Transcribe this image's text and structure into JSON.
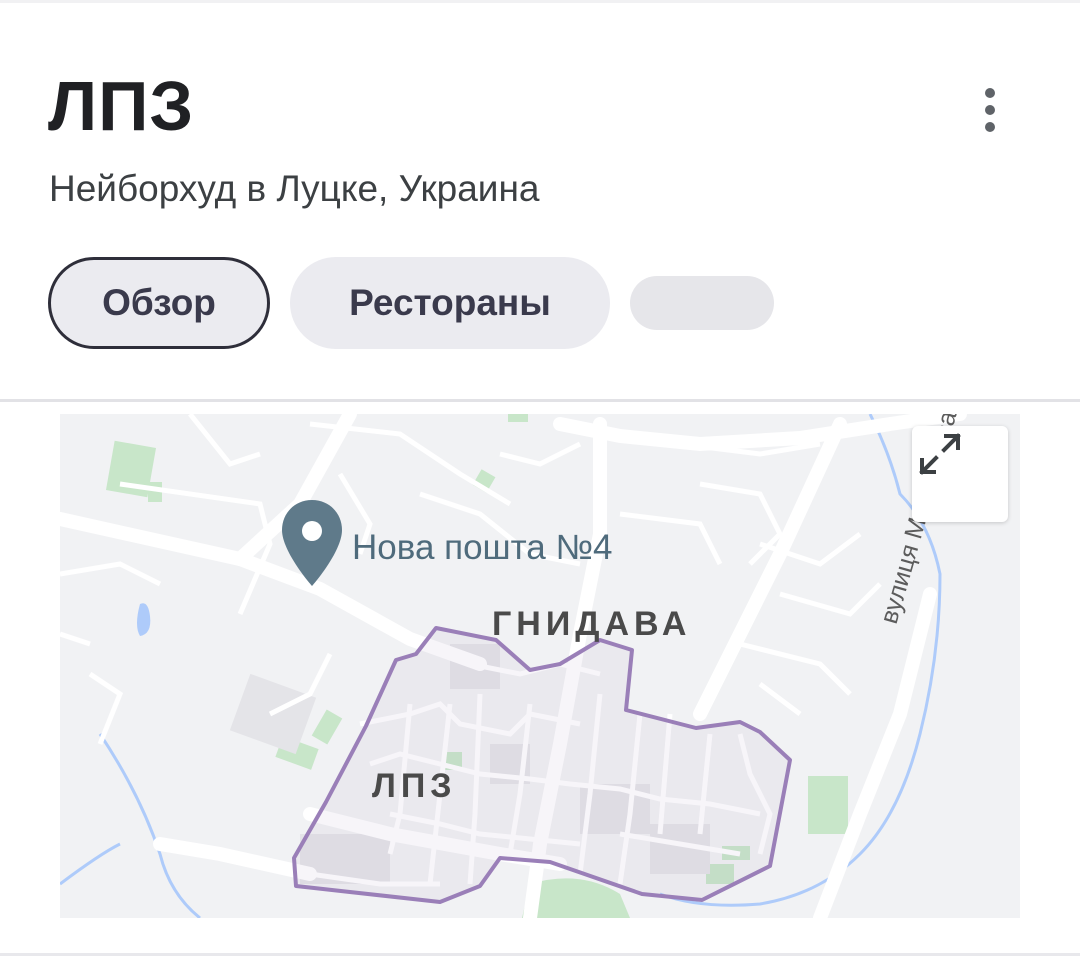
{
  "header": {
    "title": "ЛПЗ",
    "subtitle": "Нейборхуд в Луцке, Украина",
    "menu_icon": "more-vert-icon"
  },
  "chips": [
    {
      "label": "Обзор",
      "selected": true
    },
    {
      "label": "Рестораны",
      "selected": false
    },
    {
      "label": "",
      "placeholder": true
    }
  ],
  "map": {
    "poi": {
      "label": "Нова пошта №4",
      "icon": "map-pin-icon"
    },
    "areas": [
      {
        "label": "ГНИДАВА"
      },
      {
        "label": "ЛПЗ"
      }
    ],
    "street": "вулиця Мамсурова",
    "expand_icon": "expand-icon",
    "colors": {
      "background": "#f1f2f4",
      "road": "#ffffff",
      "boundary": "#9a7fb8",
      "park": "#c8e6c9",
      "water": "#aecbfa",
      "pin": "#5f7a8a"
    }
  }
}
